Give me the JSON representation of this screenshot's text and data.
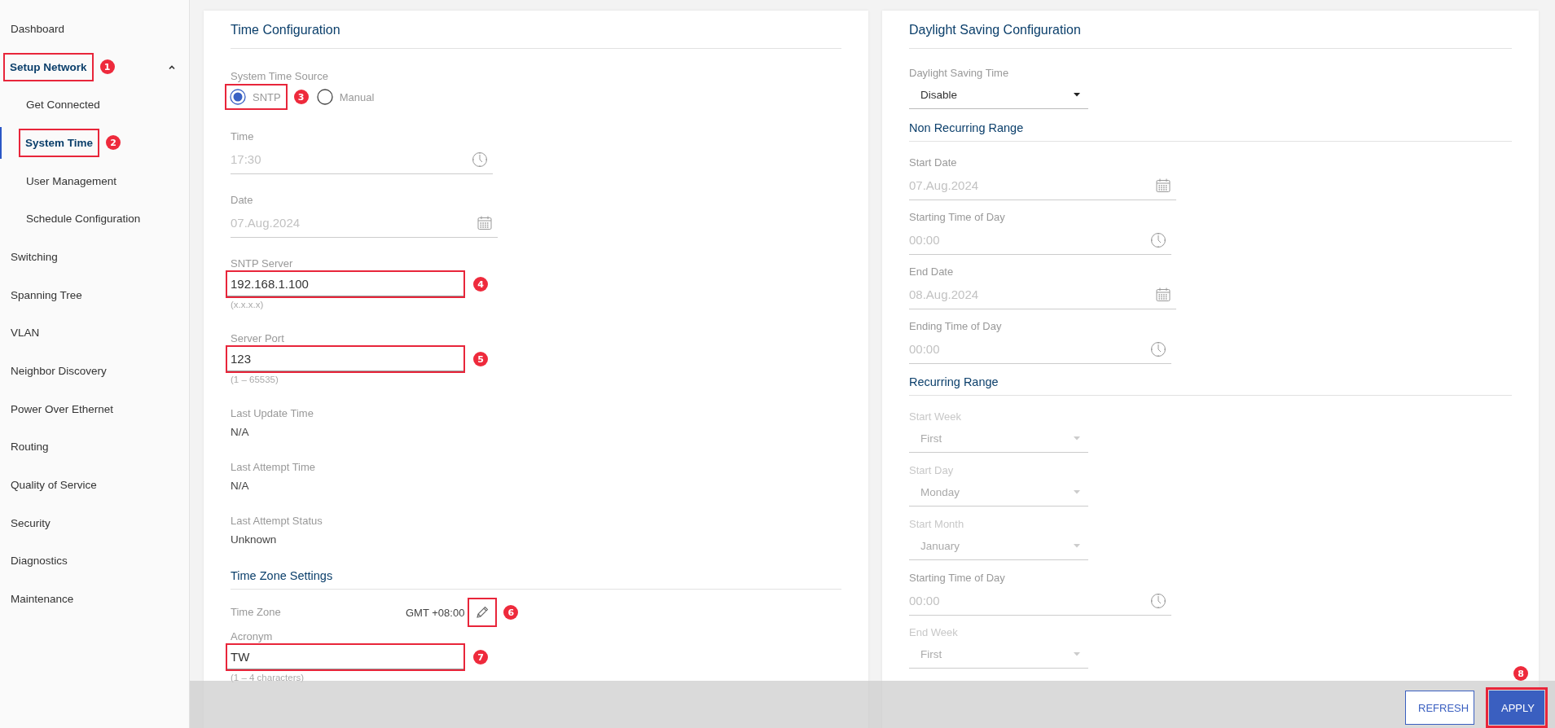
{
  "sidebar": {
    "items": [
      {
        "label": "Dashboard",
        "selected": false
      },
      {
        "label": "Setup Network",
        "selected": false,
        "expanded": true,
        "callout": "1",
        "children": [
          {
            "label": "Get Connected",
            "selected": false
          },
          {
            "label": "System Time",
            "selected": true,
            "callout": "2"
          },
          {
            "label": "User Management",
            "selected": false
          },
          {
            "label": "Schedule Configuration",
            "selected": false
          }
        ]
      },
      {
        "label": "Switching",
        "selected": false
      },
      {
        "label": "Spanning Tree",
        "selected": false
      },
      {
        "label": "VLAN",
        "selected": false
      },
      {
        "label": "Neighbor Discovery",
        "selected": false
      },
      {
        "label": "Power Over Ethernet",
        "selected": false
      },
      {
        "label": "Routing",
        "selected": false
      },
      {
        "label": "Quality of Service",
        "selected": false
      },
      {
        "label": "Security",
        "selected": false
      },
      {
        "label": "Diagnostics",
        "selected": false
      },
      {
        "label": "Maintenance",
        "selected": false
      }
    ]
  },
  "time_config": {
    "title": "Time Configuration",
    "fields": [
      {
        "kind": "radio",
        "label": "System Time Source",
        "options": [
          {
            "label": "SNTP",
            "selected": true,
            "callout": "3"
          },
          {
            "label": "Manual",
            "selected": false
          }
        ]
      },
      {
        "kind": "time",
        "label": "Time",
        "value": "17:30",
        "disabled": true
      },
      {
        "kind": "date",
        "label": "Date",
        "value": "07.Aug.2024",
        "disabled": true
      },
      {
        "kind": "text",
        "label": "SNTP Server",
        "value": "192.168.1.100",
        "hint": "(x.x.x.x)",
        "callout": "4"
      },
      {
        "kind": "text",
        "label": "Server Port",
        "value": "123",
        "hint": "(1 – 65535)",
        "callout": "5"
      },
      {
        "kind": "static",
        "label": "Last Update Time",
        "value": "N/A"
      },
      {
        "kind": "static",
        "label": "Last Attempt Time",
        "value": "N/A"
      },
      {
        "kind": "static",
        "label": "Last Attempt Status",
        "value": "Unknown"
      },
      {
        "kind": "heading",
        "label": "Time Zone Settings"
      },
      {
        "kind": "timezone",
        "label": "Time Zone",
        "value": "GMT +08:00",
        "callout": "6"
      },
      {
        "kind": "text",
        "label": "Acronym",
        "value": "TW",
        "hint": "(1 – 4 characters)",
        "callout": "7"
      }
    ]
  },
  "daylight_config": {
    "title": "Daylight Saving Configuration",
    "fields": [
      {
        "kind": "select",
        "label": "Daylight Saving Time",
        "value": "Disable",
        "disabled": false
      },
      {
        "kind": "heading",
        "label": "Non Recurring Range"
      },
      {
        "kind": "date",
        "label": "Start Date",
        "value": "07.Aug.2024",
        "disabled": true
      },
      {
        "kind": "time",
        "label": "Starting Time of Day",
        "value": "00:00",
        "disabled": true
      },
      {
        "kind": "date",
        "label": "End Date",
        "value": "08.Aug.2024",
        "disabled": true
      },
      {
        "kind": "time",
        "label": "Ending Time of Day",
        "value": "00:00",
        "disabled": true
      },
      {
        "kind": "heading",
        "label": "Recurring Range"
      },
      {
        "kind": "select",
        "label": "Start Week",
        "value": "First",
        "disabled": true
      },
      {
        "kind": "select",
        "label": "Start Day",
        "value": "Monday",
        "disabled": true
      },
      {
        "kind": "select",
        "label": "Start Month",
        "value": "January",
        "disabled": true
      },
      {
        "kind": "time",
        "label": "Starting Time of Day",
        "value": "00:00",
        "disabled": true
      },
      {
        "kind": "select",
        "label": "End Week",
        "value": "First",
        "disabled": true
      }
    ]
  },
  "footer": {
    "buttons": [
      {
        "label": "REFRESH",
        "kind": "outline"
      },
      {
        "label": "APPLY",
        "kind": "primary",
        "callout": "8"
      }
    ]
  }
}
